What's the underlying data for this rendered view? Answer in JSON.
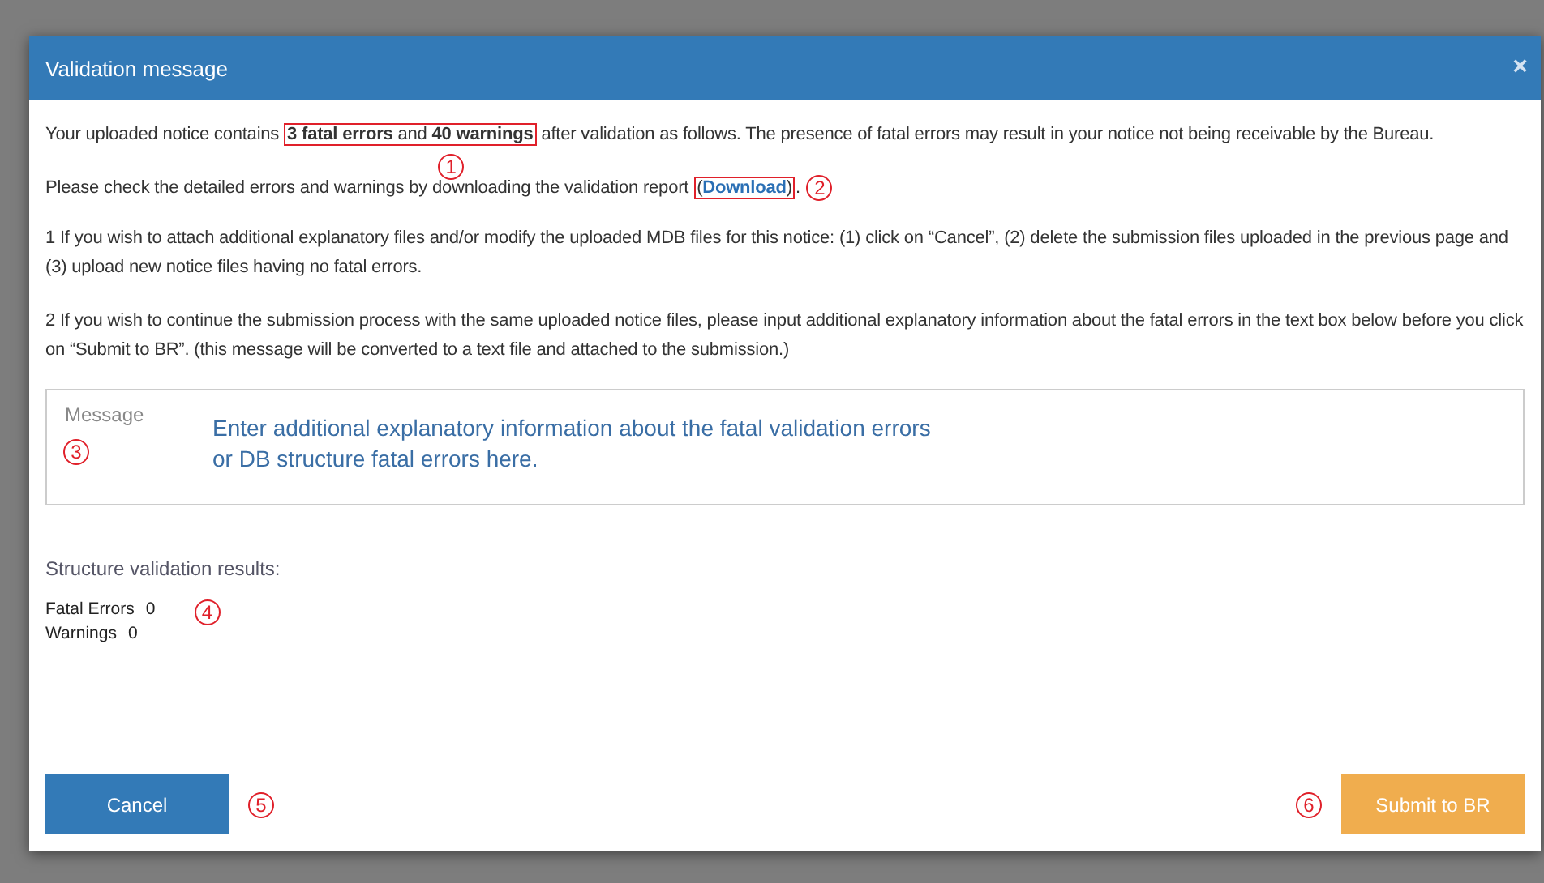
{
  "dialog": {
    "title": "Validation message",
    "close": "×",
    "intro": {
      "before": "Your uploaded notice contains ",
      "highlight": "**3 fatal errors** and  **40  warnings**",
      "after": " after validation as follows. The presence of fatal errors may result in your notice not being receivable by the Bureau.",
      "callout": "1"
    },
    "download": {
      "before": "Please check the detailed errors and warnings by downloading the validation report ",
      "open": "(",
      "link": "Download",
      "close": ")",
      "after": ".",
      "callout": "2"
    },
    "notes": [
      "1 If you wish to attach additional explanatory files and/or modify the uploaded MDB files for this notice: (1) click on “Cancel”, (2) delete the submission files uploaded in the previous page and (3) upload new notice files having no fatal errors.",
      "2 If you wish to continue the submission process with the same uploaded notice files, please input additional explanatory information about the fatal errors in the text box below before you click on “Submit to BR”. (this message will be converted to a text file and attached to the submission.)"
    ],
    "message": {
      "label": "Message",
      "placeholder": "Enter additional explanatory information about the fatal validation errors\nor DB structure fatal errors here.",
      "callout": "3"
    },
    "results": {
      "heading": "Structure validation results:",
      "rows": [
        {
          "label": "Fatal Errors",
          "value": "0"
        },
        {
          "label": "Warnings",
          "value": "0"
        }
      ],
      "callout": "4"
    },
    "cancel": {
      "label": "Cancel",
      "callout": "5"
    },
    "submit": {
      "label": "Submit to BR",
      "callout": "6"
    }
  }
}
